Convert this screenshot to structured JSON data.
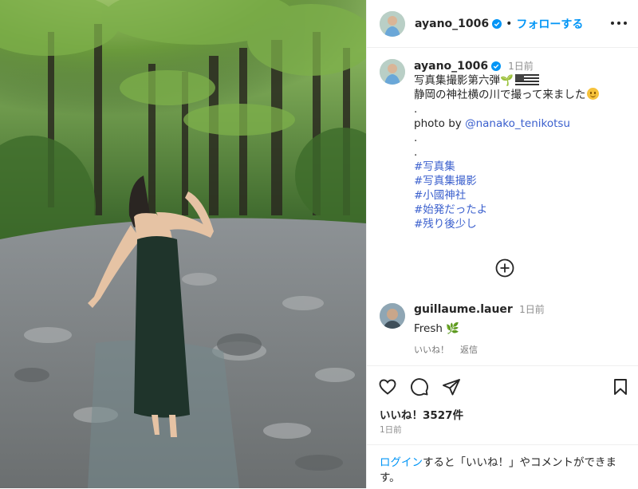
{
  "post": {
    "username": "ayano_1006",
    "follow_label": "フォローする",
    "separator": "•",
    "more_icon": "more-horizontal-icon"
  },
  "caption": {
    "username": "ayano_1006",
    "time": "1日前",
    "line1": "写真集撮影第六弾",
    "line2": "静岡の神社横の川で撮って来ました",
    "dot1": ".",
    "photo_by": "photo by ",
    "mention": "@nanako_tenikotsu",
    "dot2": ".",
    "dot3": ".",
    "hashtags": [
      "#写真集",
      "#写真集撮影",
      "#小國神社",
      "#始発だったよ",
      "#残り後少し"
    ]
  },
  "comment": {
    "username": "guillaume.lauer",
    "time": "1日前",
    "text": "Fresh",
    "like_label": "いいね！",
    "reply_label": "返信"
  },
  "actions": {
    "likes": "いいね！3527件",
    "date": "1日前",
    "login_link": "ログイン",
    "login_rest": "すると「いいね！」やコメントができます。"
  },
  "colors": {
    "link": "#0095f6",
    "hashtag": "#3a5fcd",
    "verified": "#0095f6"
  }
}
